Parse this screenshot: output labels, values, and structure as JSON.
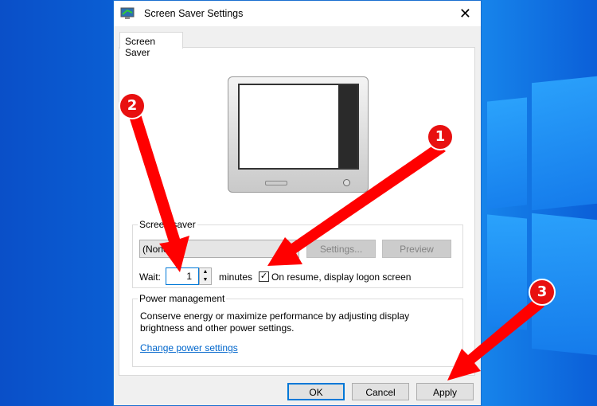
{
  "dialog": {
    "title": "Screen Saver Settings",
    "tab": "Screen Saver"
  },
  "screensaver": {
    "group_label": "Screen saver",
    "selected": "(None)",
    "settings_label": "Settings...",
    "preview_label": "Preview",
    "wait_label": "Wait:",
    "wait_value": "1",
    "minutes_label": "minutes",
    "resume_label": "On resume, display logon screen",
    "resume_checked": true
  },
  "power": {
    "group_label": "Power management",
    "description": "Conserve energy or maximize performance by adjusting display brightness and other power settings.",
    "link": "Change power settings"
  },
  "buttons": {
    "ok": "OK",
    "cancel": "Cancel",
    "apply": "Apply"
  },
  "annotations": [
    "1",
    "2",
    "3"
  ],
  "colors": {
    "accent": "#0078d7",
    "arrow": "#e81010"
  }
}
